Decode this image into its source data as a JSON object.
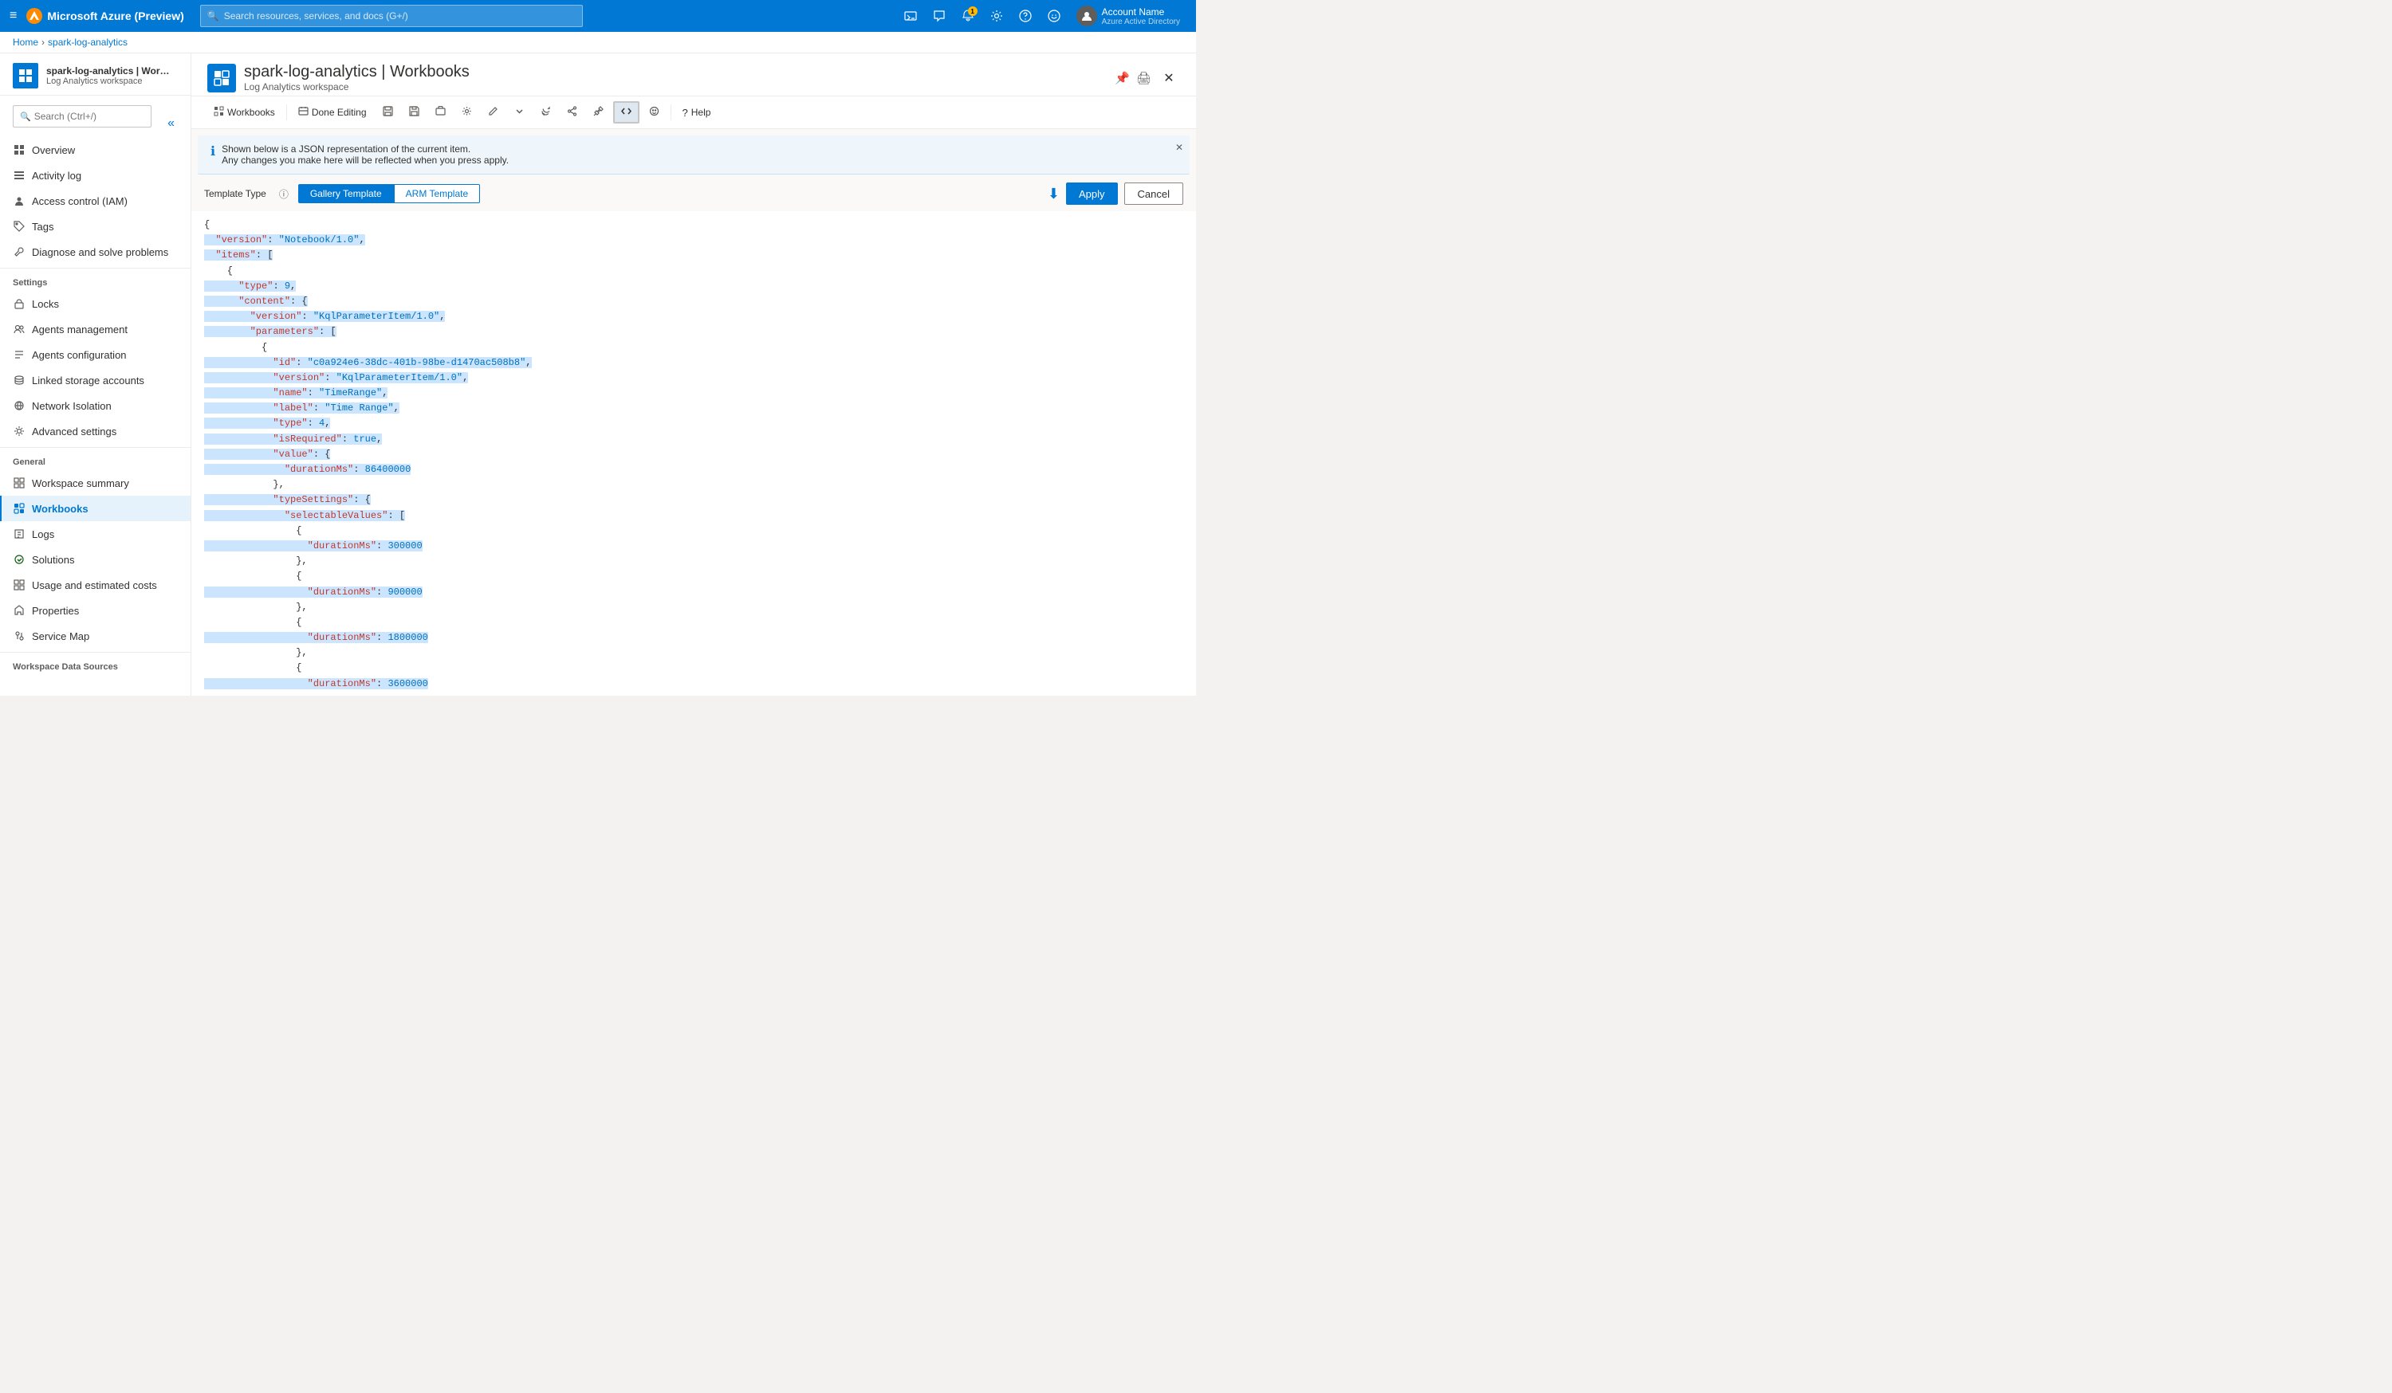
{
  "topbar": {
    "brand": "Microsoft Azure (Preview)",
    "search_placeholder": "Search resources, services, and docs (G+/)",
    "hamburger_label": "≡",
    "user_name": "Account Name",
    "user_sub": "Azure Active Directory",
    "notification_count": "1"
  },
  "breadcrumb": {
    "home": "Home",
    "resource": "spark-log-analytics"
  },
  "resource": {
    "title": "spark-log-analytics | Workbooks",
    "subtitle": "Log Analytics workspace",
    "icon_alt": "log-analytics-icon"
  },
  "toolbar": {
    "workbooks_label": "Workbooks",
    "done_editing_label": "Done Editing",
    "help_label": "Help"
  },
  "json_notice": {
    "line1": "Shown below is a JSON representation of the current item.",
    "line2": "Any changes you make here will be reflected when you press apply."
  },
  "template_type": {
    "label": "Template Type",
    "tab_gallery": "Gallery Template",
    "tab_arm": "ARM Template",
    "active": "gallery"
  },
  "actions": {
    "apply": "Apply",
    "cancel": "Cancel"
  },
  "json_content": {
    "lines": [
      {
        "text": "{",
        "indent": 0
      },
      {
        "text": "  \"version\": \"Notebook/1.0\",",
        "key": "version",
        "val": "Notebook/1.0",
        "highlight": true
      },
      {
        "text": "  \"items\": [",
        "key": "items",
        "highlight": true
      },
      {
        "text": "    {",
        "indent": 4
      },
      {
        "text": "      \"type\": 9,",
        "key": "type",
        "val": "9",
        "highlight": true
      },
      {
        "text": "      \"content\": {",
        "key": "content",
        "highlight": true
      },
      {
        "text": "        \"version\": \"KqlParameterItem/1.0\",",
        "key": "version",
        "val": "KqlParameterItem/1.0",
        "highlight": true
      },
      {
        "text": "        \"parameters\": [",
        "key": "parameters",
        "highlight": true
      },
      {
        "text": "          {",
        "indent": 10
      },
      {
        "text": "            \"id\": \"c0a924e6-38dc-401b-98be-d1470ac508b8\",",
        "key": "id",
        "val": "c0a924e6-38dc-401b-98be-d1470ac508b8",
        "highlight": true
      },
      {
        "text": "            \"version\": \"KqlParameterItem/1.0\",",
        "key": "version",
        "val": "KqlParameterItem/1.0",
        "highlight": true
      },
      {
        "text": "            \"name\": \"TimeRange\",",
        "key": "name",
        "val": "TimeRange",
        "highlight": true
      },
      {
        "text": "            \"label\": \"Time Range\",",
        "key": "label",
        "val": "Time Range",
        "highlight": true
      },
      {
        "text": "            \"type\": 4,",
        "key": "type",
        "val": "4",
        "highlight": true
      },
      {
        "text": "            \"isRequired\": true,",
        "key": "isRequired",
        "val": "true",
        "highlight": true
      },
      {
        "text": "            \"value\": {",
        "key": "value",
        "highlight": true
      },
      {
        "text": "              \"durationMs\": 86400000",
        "key": "durationMs",
        "val": "86400000",
        "highlight": true
      },
      {
        "text": "            },",
        "indent": 12
      },
      {
        "text": "            \"typeSettings\": {",
        "key": "typeSettings",
        "highlight": true
      },
      {
        "text": "              \"selectableValues\": [",
        "key": "selectableValues",
        "highlight": true
      },
      {
        "text": "                {",
        "indent": 16
      },
      {
        "text": "                  \"durationMs\": 300000",
        "key": "durationMs",
        "val": "300000",
        "highlight": true
      },
      {
        "text": "                },",
        "indent": 16
      },
      {
        "text": "                {",
        "indent": 16
      },
      {
        "text": "                  \"durationMs\": 900000",
        "key": "durationMs",
        "val": "900000",
        "highlight": true
      },
      {
        "text": "                },",
        "indent": 16
      },
      {
        "text": "                {",
        "indent": 16
      },
      {
        "text": "                  \"durationMs\": 1800000",
        "key": "durationMs",
        "val": "1800000",
        "highlight": true
      },
      {
        "text": "                },",
        "indent": 16
      },
      {
        "text": "                {",
        "indent": 16
      },
      {
        "text": "                  \"durationMs\": 3600000",
        "key": "durationMs",
        "val": "3600000",
        "highlight": true
      }
    ]
  },
  "sidebar": {
    "search_placeholder": "Search (Ctrl+/)",
    "sections": {
      "settings_label": "Settings",
      "general_label": "General",
      "workspace_label": "Workspace Data Sources"
    },
    "items": [
      {
        "id": "overview",
        "label": "Overview",
        "icon": "grid"
      },
      {
        "id": "activity-log",
        "label": "Activity log",
        "icon": "list"
      },
      {
        "id": "access-control",
        "label": "Access control (IAM)",
        "icon": "person"
      },
      {
        "id": "tags",
        "label": "Tags",
        "icon": "tag"
      },
      {
        "id": "diagnose",
        "label": "Diagnose and solve problems",
        "icon": "wrench"
      },
      {
        "id": "locks",
        "label": "Locks",
        "icon": "lock"
      },
      {
        "id": "agents-mgmt",
        "label": "Agents management",
        "icon": "agents"
      },
      {
        "id": "agents-config",
        "label": "Agents configuration",
        "icon": "config"
      },
      {
        "id": "linked-storage",
        "label": "Linked storage accounts",
        "icon": "storage"
      },
      {
        "id": "network",
        "label": "Network Isolation",
        "icon": "network"
      },
      {
        "id": "advanced",
        "label": "Advanced settings",
        "icon": "settings"
      },
      {
        "id": "workspace-summary",
        "label": "Workspace summary",
        "icon": "summary"
      },
      {
        "id": "workbooks",
        "label": "Workbooks",
        "icon": "workbooks",
        "active": true
      },
      {
        "id": "logs",
        "label": "Logs",
        "icon": "logs"
      },
      {
        "id": "solutions",
        "label": "Solutions",
        "icon": "solutions"
      },
      {
        "id": "usage-costs",
        "label": "Usage and estimated costs",
        "icon": "chart"
      },
      {
        "id": "properties",
        "label": "Properties",
        "icon": "info"
      },
      {
        "id": "service-map",
        "label": "Service Map",
        "icon": "map"
      }
    ]
  }
}
